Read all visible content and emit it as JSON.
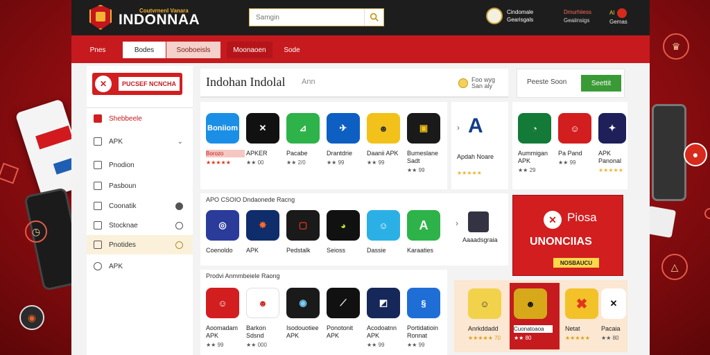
{
  "header": {
    "logo_tag": "Coutvrnenl Vanara",
    "logo_text": "INDONNAA",
    "search_placeholder": "Samgin",
    "user_line1": "Cindomale",
    "user_line2": "Gearisgals",
    "link1": "Dmurhiiess",
    "link1_sub": "Geaiinsigs",
    "link2_head": "Al",
    "link2_sub": "Gemas"
  },
  "nav": [
    "Pnes",
    "Bodes",
    "Sooboeisls",
    "Moonaoen",
    "Sode"
  ],
  "sidebar": {
    "banner": "PUCSEF NCNCHA",
    "items": [
      {
        "label": "Shebbeele",
        "highlight": true
      },
      {
        "label": "APK",
        "trail": "chev"
      },
      {
        "label": "Pnodion"
      },
      {
        "label": "Pasboun"
      },
      {
        "label": "Coonatik",
        "trail": "dot"
      },
      {
        "label": "Stocknae",
        "trail": "ring"
      },
      {
        "label": "Pnotides",
        "trail": "gold",
        "cream": true
      },
      {
        "label": "APK"
      }
    ]
  },
  "hero": {
    "title": "Indohan Indolal",
    "aux": "Ann",
    "meta1": "Foo wyg",
    "meta2": "San aly"
  },
  "promo_box": {
    "label": "Peeste Soon",
    "button": "Seettit"
  },
  "row1": {
    "apps": [
      {
        "icon": "Boniiom",
        "name": "Borozo",
        "rating": "★★★★★",
        "color": "#1b8fe6"
      },
      {
        "icon": "",
        "name": "APKER",
        "rating": "★★ 00",
        "color": "#111"
      },
      {
        "icon": "",
        "name": "Pacabe",
        "rating": "★★ 2/0",
        "color": "#2eb34a"
      },
      {
        "icon": "",
        "name": "Drantdrie",
        "rating": "★★ 99",
        "color": "#0d5fc2"
      },
      {
        "icon": "",
        "name": "Daanii APK",
        "rating": "★★ 99",
        "color": "#f2c21a"
      },
      {
        "icon": "",
        "name": "Bumeslane Sadt",
        "rating": "★★ 99",
        "color": "#1a1a1a"
      }
    ],
    "featured": {
      "name": "Apdah Noare",
      "rating": "★★★★★"
    },
    "right": [
      {
        "name": "Aummigan APK",
        "rating": "★★ 29",
        "color": "#137a38"
      },
      {
        "name": "Pa Pand",
        "rating": "★★ 99",
        "color": "#d21e1f"
      },
      {
        "name": "APK Panonal",
        "rating": "★★★★★",
        "color": "#1f1f5a"
      }
    ]
  },
  "row2": {
    "title": "APO CSOIO Dndaonede Racng",
    "apps": [
      {
        "name": "Coenoldo",
        "color": "#2a3b9a"
      },
      {
        "name": "APK",
        "color": "#0f2d6a"
      },
      {
        "name": "Pedstalk",
        "color": "#1a1a1a"
      },
      {
        "name": "Seioss",
        "color": "#111"
      },
      {
        "name": "Dassie",
        "color": "#2bb0e6"
      },
      {
        "name": "Karaaties",
        "color": "#2eb34a"
      }
    ],
    "featured": {
      "name": "Aaaadsgraia"
    }
  },
  "big_promo": {
    "t1": "Piosa",
    "t2": "UNONCIIAS",
    "t3": "NOSBAUCU"
  },
  "row3": {
    "title": "Prodvi Anmmbeiele Raong",
    "apps": [
      {
        "name": "Aoomadam APK",
        "rating": "★★ 99",
        "color": "#d21e1f"
      },
      {
        "name": "Barkon Sdsnd",
        "rating": "★★ 000",
        "color": "#fff"
      },
      {
        "name": "Isodouotiee APK",
        "rating": "",
        "color": "#1a1a1a"
      },
      {
        "name": "Ponotonit APK",
        "rating": "",
        "color": "#111"
      },
      {
        "name": "Acodoatnn APK",
        "rating": "★★ 99",
        "color": "#16275a"
      },
      {
        "name": "Portidatioin Ronnat",
        "rating": "★★ 99",
        "color": "#1f6ed6"
      }
    ],
    "right": [
      {
        "name": "Anrkddadd",
        "rating": "★★★★★ 70",
        "color": "#f2d24a"
      },
      {
        "name": "Cuonatoaoa",
        "rating": "★★ 80",
        "color": "#d6a81a"
      },
      {
        "name": "Netat",
        "rating": "★★★★★",
        "color": "#f3c229"
      },
      {
        "name": "Pacaia",
        "rating": "★★ 80",
        "color": "#fff"
      }
    ]
  },
  "colors": {
    "brand_red": "#c61a1e",
    "dark": "#1d1d1d",
    "green": "#3a9a35",
    "gold": "#f2b233"
  }
}
